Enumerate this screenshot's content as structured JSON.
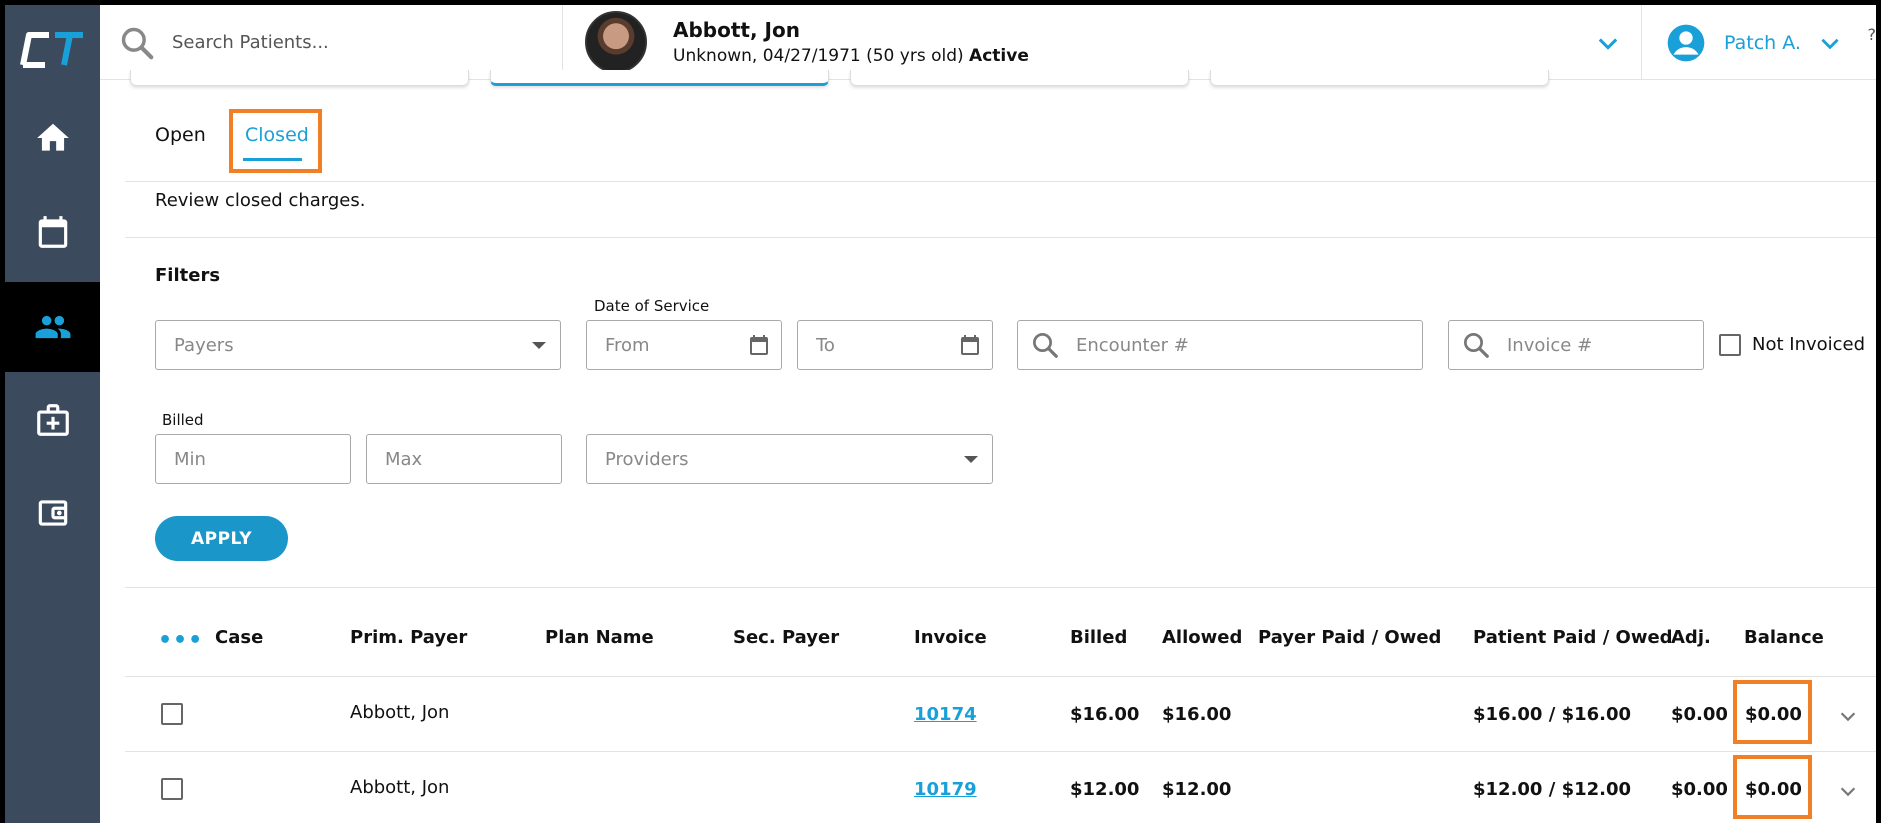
{
  "app": {
    "logo_text": "CT"
  },
  "sidebar": {
    "items": [
      {
        "name": "home",
        "icon": "home-icon"
      },
      {
        "name": "calendar",
        "icon": "calendar-icon"
      },
      {
        "name": "patients",
        "icon": "people-icon",
        "active": true
      },
      {
        "name": "medical",
        "icon": "medical-case-icon"
      },
      {
        "name": "wallet",
        "icon": "wallet-icon"
      }
    ]
  },
  "header": {
    "search_placeholder": "Search Patients...",
    "patient_name": "Abbott, Jon",
    "patient_details": "Unknown, 04/27/1971 (50 yrs old)",
    "patient_status": "Active",
    "user_name": "Patch A.",
    "edge_char": "?"
  },
  "tabs": [
    {
      "label": "Open",
      "active": false
    },
    {
      "label": "Closed",
      "active": true
    }
  ],
  "description": "Review closed charges.",
  "filters": {
    "title": "Filters",
    "payers_placeholder": "Payers",
    "date_of_service_label": "Date of Service",
    "from_placeholder": "From",
    "to_placeholder": "To",
    "encounter_placeholder": "Encounter #",
    "invoice_placeholder": "Invoice #",
    "not_invoiced_label": "Not Invoiced",
    "billed_label": "Billed",
    "min_placeholder": "Min",
    "max_placeholder": "Max",
    "providers_placeholder": "Providers",
    "apply_label": "APPLY"
  },
  "table": {
    "more_icon": "•••",
    "columns": [
      "Case",
      "Prim. Payer",
      "Plan Name",
      "Sec. Payer",
      "Invoice",
      "Billed",
      "Allowed",
      "Payer Paid / Owed",
      "Patient Paid / Owed",
      "Adj.",
      "Balance"
    ],
    "rows": [
      {
        "case": "",
        "prim_payer": "Abbott, Jon",
        "plan_name": "",
        "sec_payer": "",
        "invoice": "10174",
        "billed": "$16.00",
        "allowed": "$16.00",
        "payer_paid_owed": "",
        "patient_paid_owed": "$16.00 / $16.00",
        "adj": "$0.00",
        "balance": "$0.00"
      },
      {
        "case": "",
        "prim_payer": "Abbott, Jon",
        "plan_name": "",
        "sec_payer": "",
        "invoice": "10179",
        "billed": "$12.00",
        "allowed": "$12.00",
        "payer_paid_owed": "",
        "patient_paid_owed": "$12.00 / $12.00",
        "adj": "$0.00",
        "balance": "$0.00"
      }
    ]
  },
  "colors": {
    "accent": "#1aa0d8",
    "sidebar": "#3b4b5d",
    "highlight": "#f07f25"
  }
}
